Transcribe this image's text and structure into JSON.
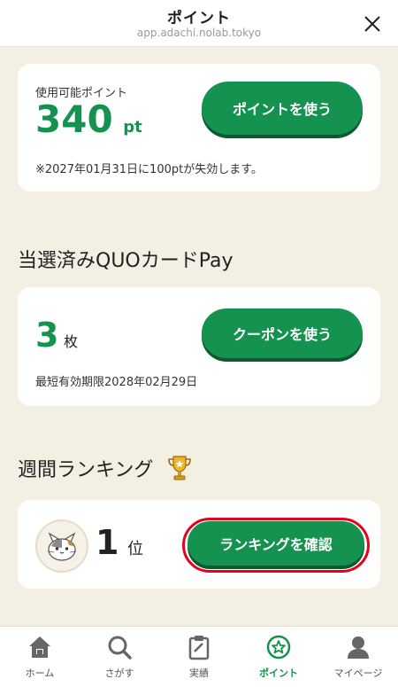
{
  "header": {
    "title": "ポイント",
    "url": "app.adachi.nolab.tokyo"
  },
  "points": {
    "label": "使用可能ポイント",
    "value": "340",
    "unit": "pt",
    "button": "ポイントを使う",
    "note": "※2027年01月31日に100ptが失効します。"
  },
  "quo": {
    "section_title": "当選済みQUOカードPay",
    "count": "3",
    "unit": "枚",
    "button": "クーポンを使う",
    "expiry": "最短有効期限2028年02月29日"
  },
  "ranking": {
    "section_title": "週間ランキング",
    "rank": "1",
    "unit": "位",
    "button": "ランキングを確認"
  },
  "nav": [
    {
      "label": "ホーム",
      "icon": "home-icon"
    },
    {
      "label": "さがす",
      "icon": "search-icon"
    },
    {
      "label": "実績",
      "icon": "clipboard-icon"
    },
    {
      "label": "ポイント",
      "icon": "star-icon"
    },
    {
      "label": "マイページ",
      "icon": "person-icon"
    }
  ],
  "colors": {
    "accent": "#15924f",
    "background": "#f4efe3",
    "highlight": "#e8001c"
  }
}
